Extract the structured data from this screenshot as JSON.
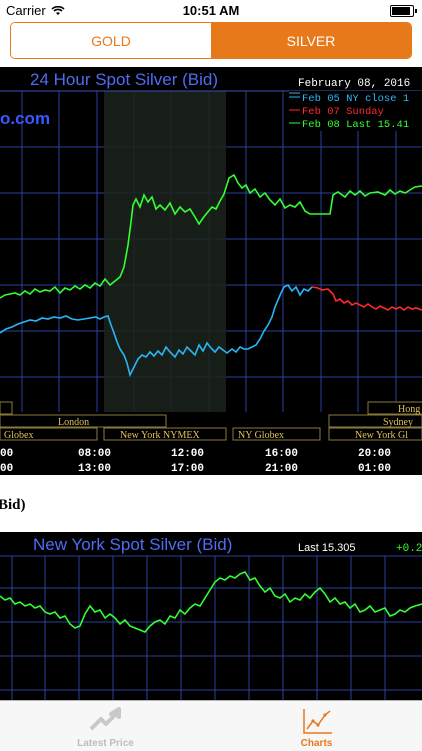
{
  "status_bar": {
    "carrier": "Carrier",
    "time": "10:51 AM"
  },
  "segment": {
    "gold_label": "GOLD",
    "silver_label": "SILVER",
    "selected": "SILVER"
  },
  "chart1": {
    "title": "24 Hour Spot Silver (Bid)",
    "date": "February 08, 2016",
    "watermark": "o.com",
    "legend": [
      {
        "text": "Feb 05 NY close 1",
        "color": "#29b6f6"
      },
      {
        "text": "Feb 07 Sunday",
        "color": "#ff2a2a"
      },
      {
        "text": "Feb 08 Last 15.41",
        "color": "#33ff33"
      }
    ],
    "sessions_row1": [
      "Hong"
    ],
    "sessions_row2": [
      "London",
      "Sydney"
    ],
    "sessions_row3": [
      "Globex",
      "New York NYMEX",
      "NY Globex",
      "New York Gl"
    ],
    "times_row1": [
      "00",
      "08:00",
      "12:00",
      "16:00",
      "20:00"
    ],
    "times_row2": [
      "00",
      "13:00",
      "17:00",
      "21:00",
      "01:00"
    ]
  },
  "caption": "Bid)",
  "chart2": {
    "title": "New York Spot Silver (Bid)",
    "last": "Last 15.305",
    "change": "+0.2"
  },
  "tabbar": {
    "tabs": [
      {
        "label": "Latest Price",
        "active": false
      },
      {
        "label": "Charts",
        "active": true
      }
    ]
  },
  "colors": {
    "accent": "#e8791a",
    "green": "#33ff33",
    "blue": "#29b6f6",
    "red": "#ff2a2a",
    "grid": "#2a3f9e",
    "gold_text": "#c9a227"
  }
}
